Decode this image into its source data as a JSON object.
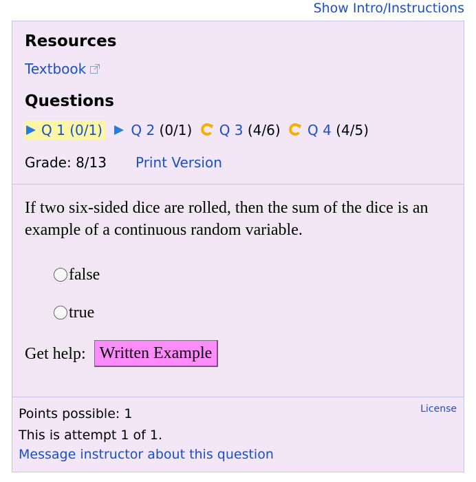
{
  "top": {
    "show_intro_label": "Show Intro/Instructions"
  },
  "resources": {
    "heading": "Resources",
    "textbook_label": "Textbook"
  },
  "questions": {
    "heading": "Questions",
    "items": [
      {
        "label": "Q 1",
        "score": "(0/1)",
        "icon": "play-triangle-icon",
        "current": true
      },
      {
        "label": "Q 2",
        "score": "(0/1)",
        "icon": "play-triangle-icon",
        "current": false
      },
      {
        "label": "Q 3",
        "score": "(4/6)",
        "icon": "retry-icon",
        "current": false
      },
      {
        "label": "Q 4",
        "score": "(4/5)",
        "icon": "retry-icon",
        "current": false
      }
    ],
    "grade_text": "Grade: 8/13",
    "print_label": "Print Version"
  },
  "question": {
    "text": "If two six-sided dice are rolled, then the sum of the dice is an example of a continuous random variable.",
    "options": [
      "false",
      "true"
    ],
    "help_label": "Get help:",
    "help_button": "Written Example"
  },
  "footer": {
    "points": "Points possible: 1",
    "attempt": "This is attempt 1 of 1.",
    "message_link": "Message instructor about this question",
    "license": "License"
  },
  "colors": {
    "link": "#1a4fc6",
    "panel_bg": "#f3e6f6",
    "panel_border": "#c5c3e3",
    "triangle": "#2b7bd8",
    "retry": "#f0b400",
    "current_highlight": "#fcf7a6",
    "help_button_bg": "#fc8cfa"
  }
}
